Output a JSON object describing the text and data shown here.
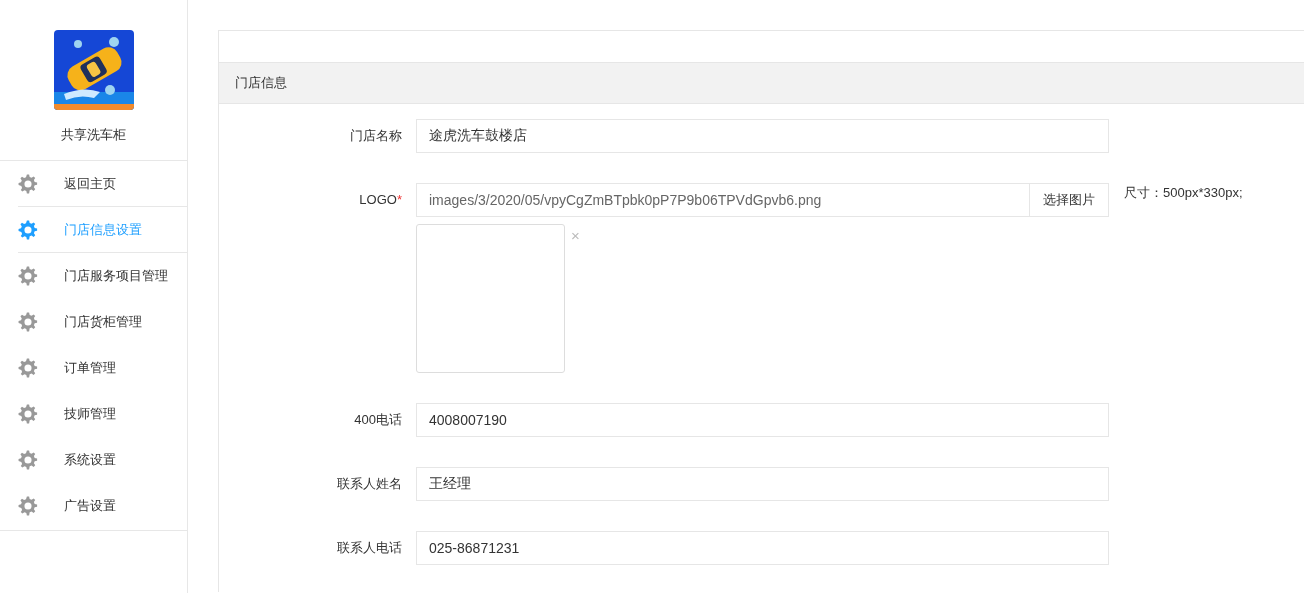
{
  "sidebar": {
    "app_name": "共享洗车柜",
    "items": [
      {
        "label": "返回主页",
        "selected": false
      },
      {
        "label": "门店信息设置",
        "selected": true
      },
      {
        "label": "门店服务项目管理",
        "selected": false
      },
      {
        "label": "门店货柜管理",
        "selected": false
      },
      {
        "label": "订单管理",
        "selected": false
      },
      {
        "label": "技师管理",
        "selected": false
      },
      {
        "label": "系统设置",
        "selected": false
      },
      {
        "label": "广告设置",
        "selected": false
      }
    ]
  },
  "panel": {
    "title": "门店信息",
    "fields": [
      {
        "kind": "text",
        "label": "门店名称",
        "value": "途虎洗车鼓楼店"
      },
      {
        "label": "LOGO",
        "required_mark": "*",
        "value": "images/3/2020/05/vpyCgZmBTpbk0pP7P9b06TPVdGpvb6.png",
        "button": "选择图片",
        "hint": "尺寸：500px*330px;",
        "remove": "×"
      },
      {
        "kind": "text",
        "label": "400电话",
        "value": "4008007190"
      },
      {
        "kind": "text",
        "label": "联系人姓名",
        "value": "王经理"
      },
      {
        "kind": "text",
        "label": "联系人电话",
        "value": "025-86871231"
      }
    ]
  }
}
